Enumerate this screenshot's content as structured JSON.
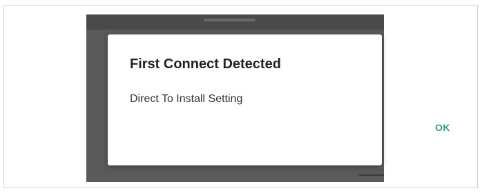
{
  "dialog": {
    "title": "First Connect Detected",
    "message": "Direct To Install Setting",
    "ok_label": "OK"
  },
  "colors": {
    "accent": "#2e9d7b",
    "backdrop": "#5a5a5a",
    "dialog_bg": "#ffffff",
    "title_text": "#222222"
  }
}
